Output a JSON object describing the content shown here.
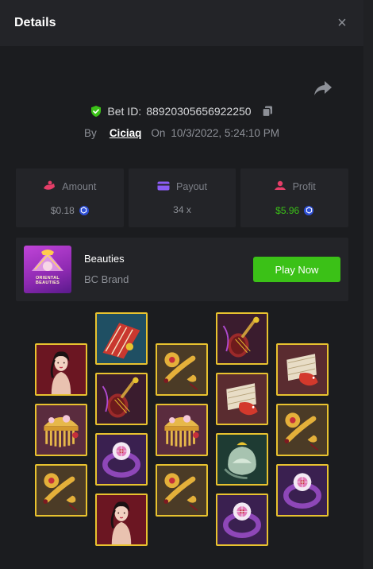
{
  "modal": {
    "title": "Details",
    "close_icon": "×"
  },
  "bet": {
    "label": "Bet ID:",
    "id": "88920305656922250",
    "by_label": "By",
    "user": "Ciciaq",
    "on_label": "On",
    "datetime": "10/3/2022, 5:24:10 PM"
  },
  "stats": {
    "amount": {
      "label": "Amount",
      "value": "$0.18",
      "icon": "amount-icon"
    },
    "payout": {
      "label": "Payout",
      "value": "34 x",
      "icon": "payout-icon"
    },
    "profit": {
      "label": "Profit",
      "value": "$5.96",
      "icon": "profit-icon"
    }
  },
  "game": {
    "name": "Beauties",
    "brand": "BC Brand",
    "play_label": "Play Now",
    "thumb_text": "ORIENTAL BEAUTIES"
  },
  "colors": {
    "green": "#3bc117",
    "tile_border": "#e8c22f",
    "background": "#1b1c1f"
  },
  "reels": [
    [
      "beauty",
      "comb",
      "ruyi"
    ],
    [
      "fan",
      "pipa",
      "ring",
      "beauty"
    ],
    [
      "ruyi",
      "comb",
      "ruyi"
    ],
    [
      "pipa",
      "koi",
      "teapot",
      "ring"
    ],
    [
      "koi",
      "ruyi",
      "ring"
    ]
  ]
}
